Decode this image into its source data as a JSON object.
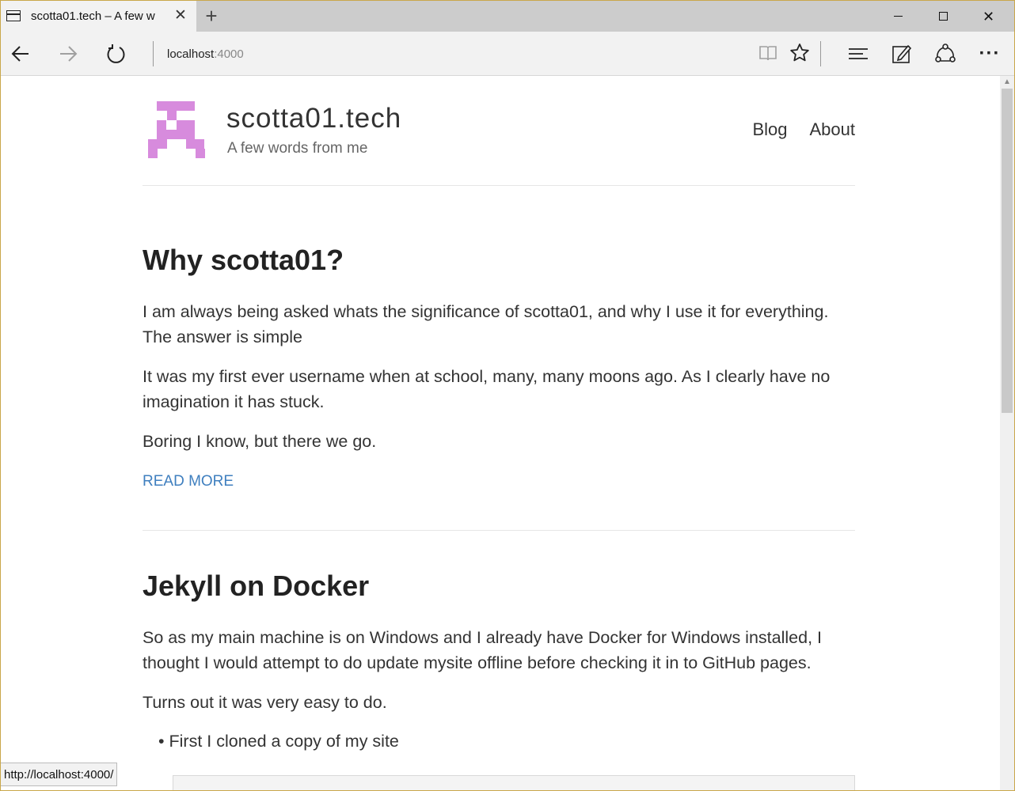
{
  "browser": {
    "tab_title": "scotta01.tech – A few w",
    "tab_close": "✕",
    "new_tab": "+",
    "address_host": "localhost",
    "address_port": ":4000",
    "status_url": "http://localhost:4000/"
  },
  "icons": {
    "back": "arrow-left-icon",
    "forward": "arrow-right-icon",
    "refresh": "refresh-icon",
    "reading_view": "reading-view-icon",
    "favorite": "star-icon",
    "hub": "hub-icon",
    "web_note": "web-note-icon",
    "share": "share-icon",
    "more": "more-icon"
  },
  "site": {
    "title": "scotta01.tech",
    "description": "A few words from me",
    "nav": [
      "Blog",
      "About"
    ],
    "logo_color": "#d78bdd"
  },
  "posts": [
    {
      "title": "Why scotta01?",
      "paragraphs": [
        "I am always being asked whats the significance of scotta01, and why I use it for everything. The answer is simple",
        "It was my first ever username when at school, many, many moons ago. As I clearly have no imagination it has stuck.",
        "Boring I know, but there we go."
      ],
      "read_more": "READ MORE"
    },
    {
      "title": "Jekyll on Docker",
      "paragraphs": [
        "So as my main machine is on Windows and I already have Docker for Windows installed, I thought I would attempt to do update mysite offline before checking it in to GitHub pages.",
        "Turns out it was very easy to do."
      ],
      "bullets": [
        "First I cloned a copy of my site"
      ]
    }
  ],
  "colors": {
    "link": "#3f7fbf",
    "text": "#333333",
    "heading": "#222222"
  }
}
